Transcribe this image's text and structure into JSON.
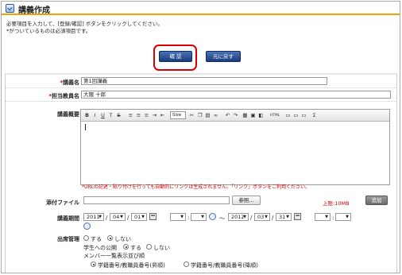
{
  "header": {
    "title": "講義作成"
  },
  "notes": [
    "必要項目を入力して、[登録/確認] ボタンをクリックしてください。",
    "*がついているものは必須項目です。"
  ],
  "buttons": {
    "confirm": "確 認",
    "back": "元に戻す"
  },
  "form": {
    "lecture_name": {
      "label": "講義名",
      "value": "第1回講義"
    },
    "teacher": {
      "label": "担当教員名",
      "value": "大隈 十郎"
    },
    "overview": {
      "label": "講義概要",
      "font_size": "Size",
      "html": "HTML",
      "warning": "*URLの記述・貼り付けを行っても自動的にリンクは生成されません。「リンク」ボタンをご利用ください。"
    },
    "attachment": {
      "label": "添付ファイル",
      "browse": "参照...",
      "limit": "上限:10MB",
      "add": "追加"
    },
    "period": {
      "label": "講義期間",
      "start": {
        "year": "2011",
        "month": "04",
        "day": "01"
      },
      "end": {
        "year": "2012",
        "month": "03",
        "day": "31"
      },
      "sep": "/",
      "tilde": "〜"
    },
    "attendance": {
      "label": "出席管理",
      "opt_yes": "する",
      "opt_no": "しない",
      "student_label": "学生への公開",
      "member_label": "メンバー一覧表示並び順",
      "sort_asc": "学籍番号/教職員番号(昇順)",
      "sort_desc": "学籍番号/教職員番号(降順)"
    }
  },
  "colors": {
    "accent": "#f0a000",
    "button": "#1c3d7c",
    "required": "#d40000",
    "highlight": "#d80000"
  }
}
